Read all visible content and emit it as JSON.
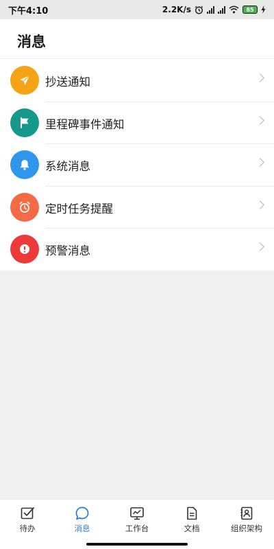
{
  "status_bar": {
    "time": "下午4:10",
    "network_speed": "2.2K/s",
    "battery_level": "85",
    "icons": [
      "alarm-icon",
      "signal-icon",
      "signal-icon",
      "wifi-icon",
      "battery-icon",
      "charging-icon"
    ]
  },
  "header": {
    "title": "消息"
  },
  "messages": [
    {
      "label": "抄送通知",
      "icon": "paper-plane-icon",
      "color": "#f6a416"
    },
    {
      "label": "里程碑事件通知",
      "icon": "flag-icon",
      "color": "#16998a"
    },
    {
      "label": "系统消息",
      "icon": "bell-icon",
      "color": "#2e96ec"
    },
    {
      "label": "定时任务提醒",
      "icon": "alarm-clock-icon",
      "color": "#f46a45"
    },
    {
      "label": "预警消息",
      "icon": "alert-icon",
      "color": "#ec3a3a"
    }
  ],
  "tabbar": {
    "active_color": "#2b77d8",
    "tabs": [
      {
        "label": "待办",
        "icon": "checkbox-icon",
        "active": false
      },
      {
        "label": "消息",
        "icon": "chat-bubble-icon",
        "active": true
      },
      {
        "label": "工作台",
        "icon": "monitor-icon",
        "active": false
      },
      {
        "label": "文档",
        "icon": "document-icon",
        "active": false
      },
      {
        "label": "组织架构",
        "icon": "contacts-icon",
        "active": false
      }
    ]
  }
}
